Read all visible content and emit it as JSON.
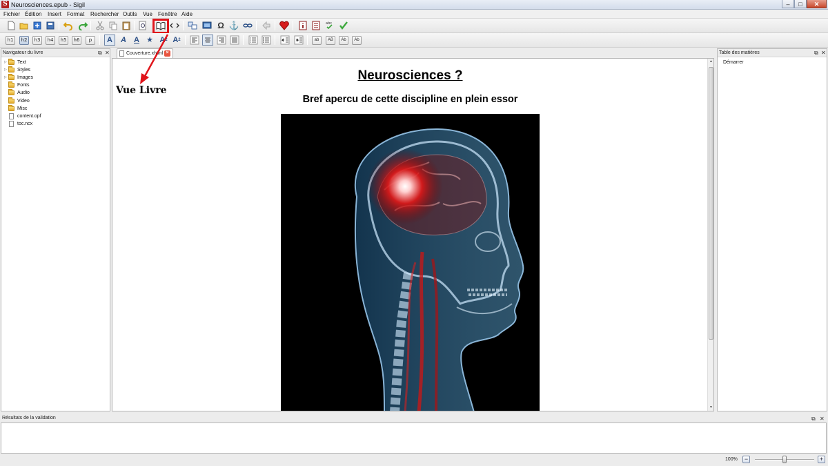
{
  "window": {
    "title": "Neurosciences.epub - Sigil",
    "minimize": "–",
    "maximize": "□",
    "close": "✕"
  },
  "menu": [
    "Fichier",
    "Édition",
    "Insert",
    "Format",
    "Rechercher",
    "Outils",
    "Vue",
    "Fenêtre",
    "Aide"
  ],
  "toolbar2": {
    "headings": [
      "h1",
      "h2",
      "h3",
      "h4",
      "h5",
      "h6",
      "p"
    ],
    "case_buttons": [
      "ab",
      "AB",
      "Ab",
      "Ab"
    ]
  },
  "book_browser": {
    "title": "Navigateur du livre",
    "items": [
      {
        "label": "Text",
        "type": "folder"
      },
      {
        "label": "Styles",
        "type": "folder"
      },
      {
        "label": "Images",
        "type": "folder"
      },
      {
        "label": "Fonts",
        "type": "folder"
      },
      {
        "label": "Audio",
        "type": "folder"
      },
      {
        "label": "Video",
        "type": "folder"
      },
      {
        "label": "Misc",
        "type": "folder"
      },
      {
        "label": "content.opf",
        "type": "file"
      },
      {
        "label": "toc.ncx",
        "type": "file"
      }
    ]
  },
  "toc": {
    "title": "Table des matières",
    "items": [
      "Démarrer"
    ]
  },
  "editor": {
    "tab_label": "Couverture.xhtml",
    "doc_title": "Neurosciences ?",
    "doc_subtitle": "Bref apercu de cette discipline en plein essor"
  },
  "annotation": {
    "text": "Vue Livre",
    "color": "#e0151b"
  },
  "validation": {
    "title": "Résultats de la validation"
  },
  "status": {
    "zoom": "100%",
    "zoom_level": 1.0
  }
}
